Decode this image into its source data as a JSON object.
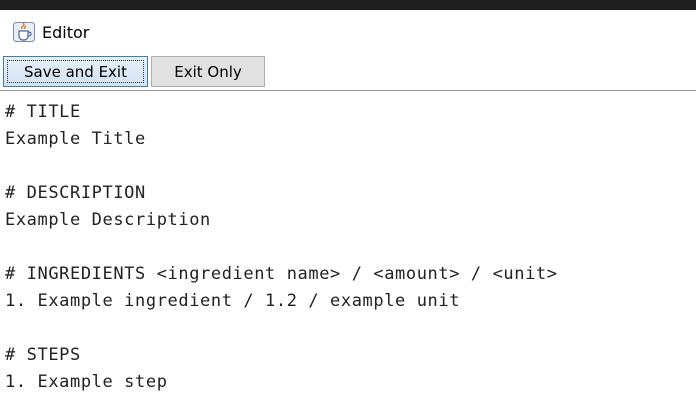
{
  "window": {
    "title": "Editor",
    "icon": "java-cup-icon"
  },
  "toolbar": {
    "save_and_exit_label": "Save and Exit",
    "exit_only_label": "Exit Only"
  },
  "editor": {
    "lines": [
      "# TITLE",
      "Example Title",
      "",
      "# DESCRIPTION",
      "Example Description",
      "",
      "# INGREDIENTS <ingredient name> / <amount> / <unit>",
      "1. Example ingredient / 1.2 / example unit",
      "",
      "# STEPS",
      "1. Example step"
    ]
  }
}
